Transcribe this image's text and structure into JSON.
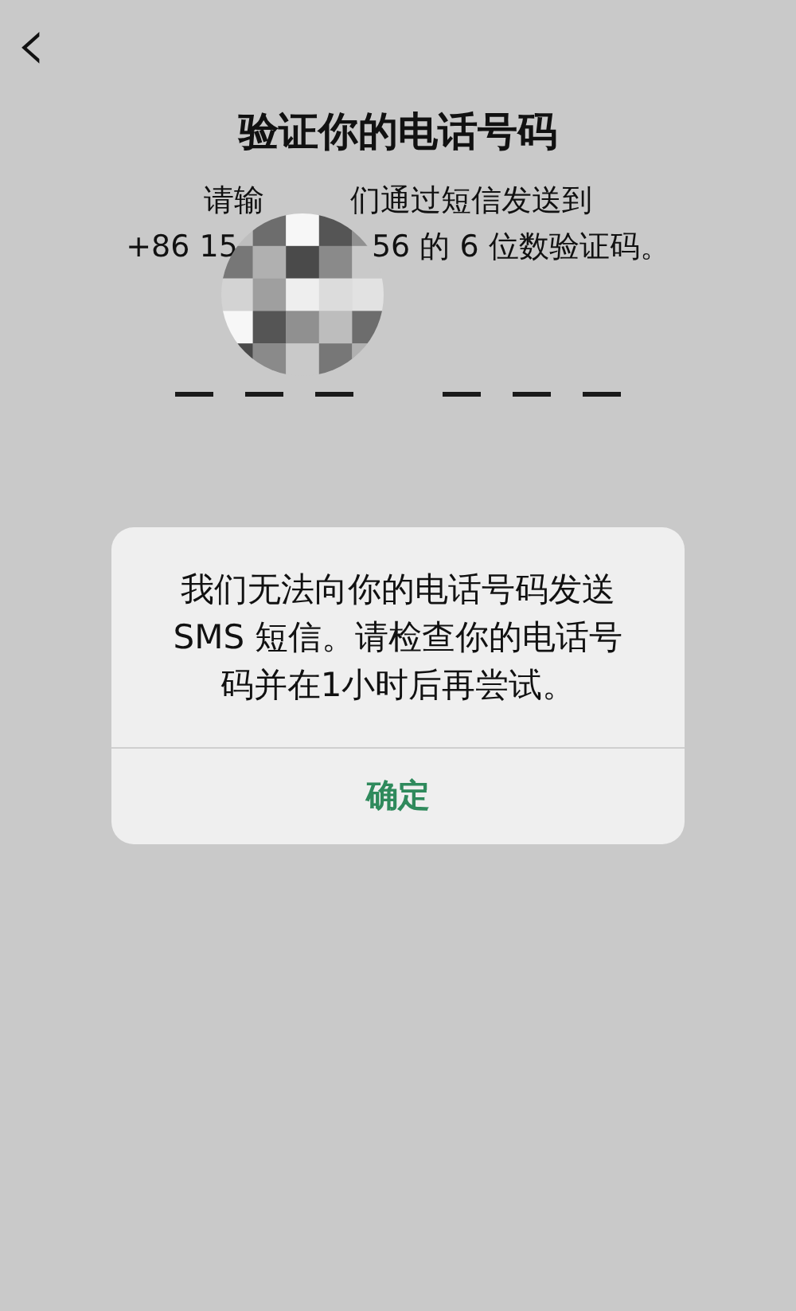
{
  "nav": {
    "back": "‹"
  },
  "title": "验证你的电话号码",
  "instructions": [
    {
      "before": "请输",
      "after": "们通过短信发送到"
    },
    {
      "before": "+86 15",
      "after": "56 的 6 位数验证码。"
    }
  ],
  "code_slot_groups": [
    [
      {
        "filled": false
      },
      {
        "filled": false
      },
      {
        "filled": false
      }
    ],
    [
      {
        "filled": false
      },
      {
        "filled": false
      },
      {
        "filled": false
      }
    ]
  ],
  "alert": {
    "message": "我们无法向你的电话号码发送 SMS 短信。请检查你的电话号码并在1小时后再尝试。",
    "button": "确定"
  }
}
